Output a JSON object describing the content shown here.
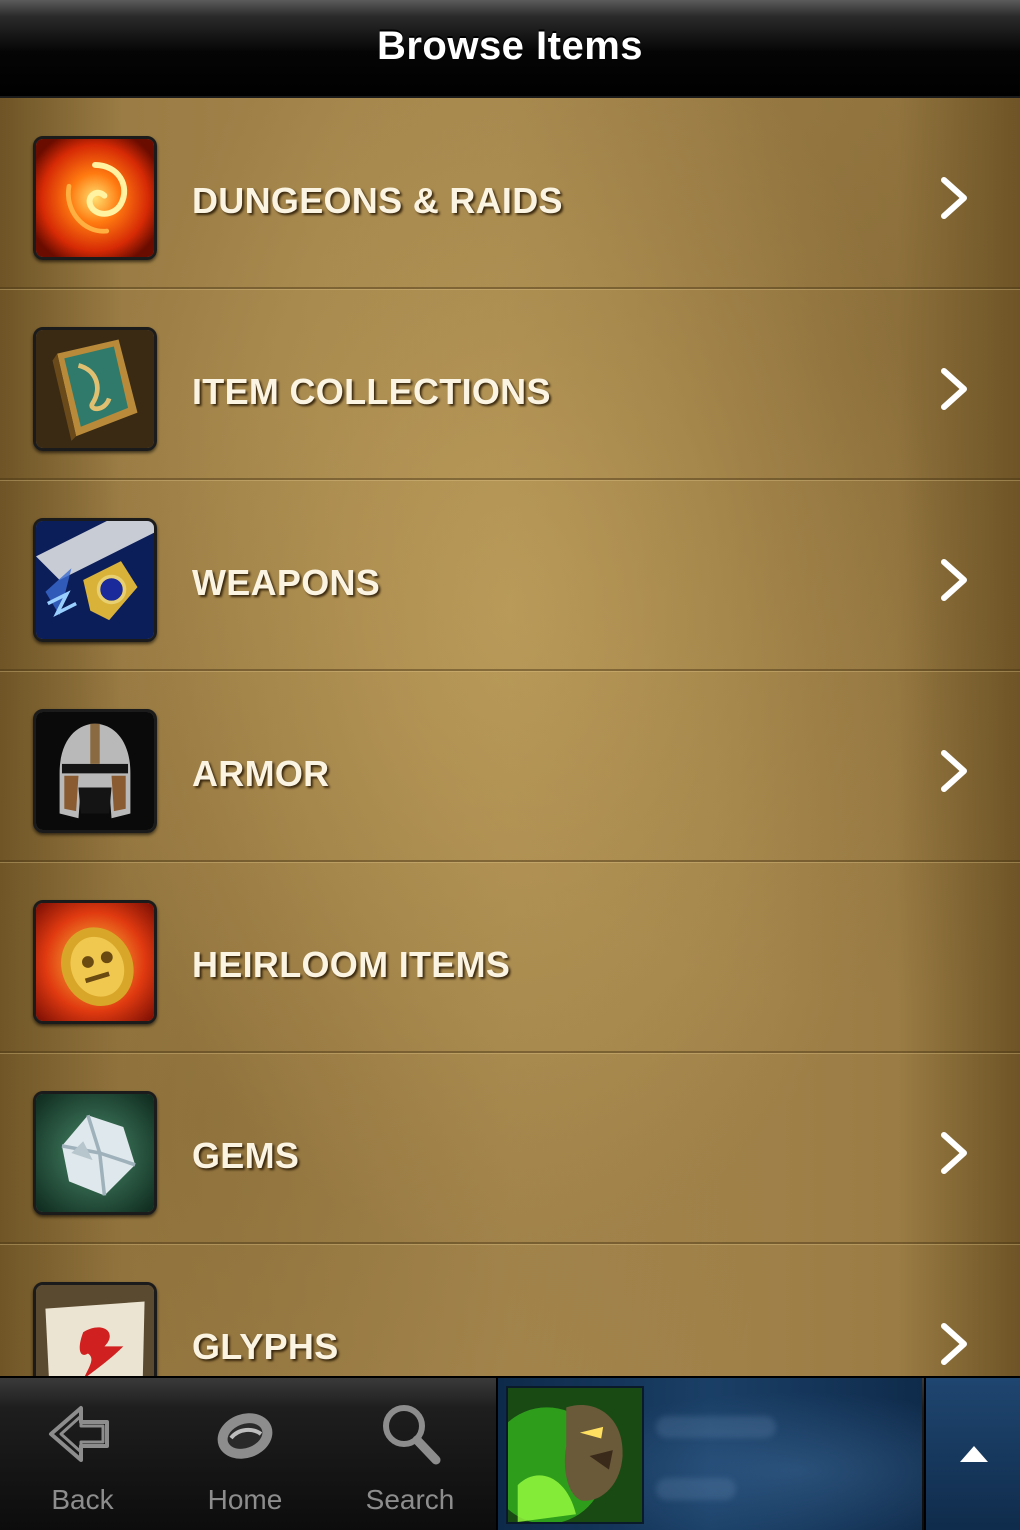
{
  "navbar": {
    "title": "Browse Items"
  },
  "list": {
    "items": [
      {
        "label": "DUNGEONS & RAIDS",
        "icon": "fire-vortex-icon",
        "has_chevron": true
      },
      {
        "label": "ITEM COLLECTIONS",
        "icon": "book-icon",
        "has_chevron": true
      },
      {
        "label": "WEAPONS",
        "icon": "sword-icon",
        "has_chevron": true
      },
      {
        "label": "ARMOR",
        "icon": "helmet-icon",
        "has_chevron": true
      },
      {
        "label": "HEIRLOOM ITEMS",
        "icon": "golden-shield-icon",
        "has_chevron": false
      },
      {
        "label": "GEMS",
        "icon": "gem-icon",
        "has_chevron": true
      },
      {
        "label": "GLYPHS",
        "icon": "scroll-glyph-icon",
        "has_chevron": true
      }
    ]
  },
  "tabbar": {
    "back_label": "Back",
    "home_label": "Home",
    "search_label": "Search"
  },
  "character": {
    "portrait_icon": "character-portrait-icon"
  },
  "colors": {
    "navbar": "#000000",
    "parchment": "#a88a50",
    "row_text": "#fbf4e2",
    "tab_text": "#8d8d8d",
    "character_panel": "#1a3f66"
  }
}
